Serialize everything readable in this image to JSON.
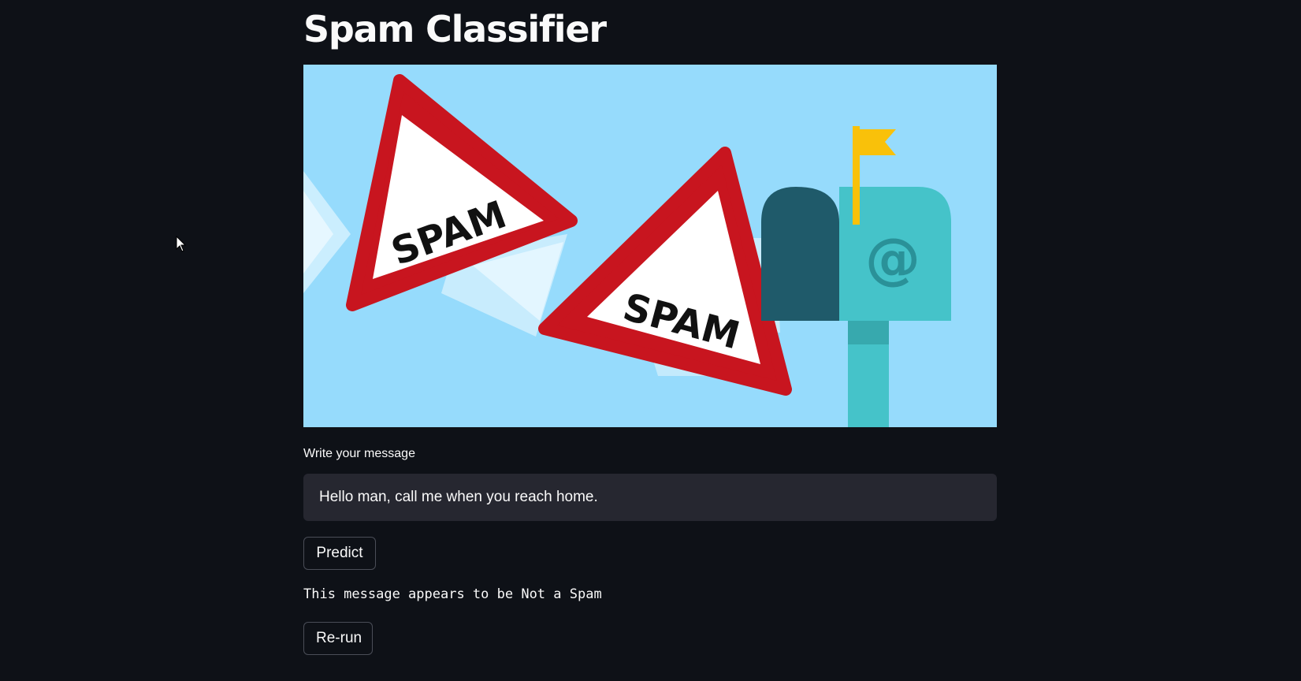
{
  "app": {
    "title": "Spam Classifier"
  },
  "hero_image": {
    "sign_text_1": "SPAM",
    "sign_text_2": "SPAM",
    "mailbox_symbol": "@",
    "colors": {
      "sky": "#96dbfc",
      "sign_red": "#c8151f",
      "mailbox_teal": "#45c3c9",
      "mailbox_dark": "#1f5a6a",
      "flag": "#f9c10a"
    }
  },
  "form": {
    "message_label": "Write your message",
    "message_value": "Hello man, call me when you reach home.",
    "predict_label": "Predict",
    "result_text": "This message appears to be Not a Spam",
    "rerun_label": "Re-run"
  },
  "theme": {
    "background": "#0e1117",
    "input_background": "#262730",
    "text": "#fafafa"
  }
}
